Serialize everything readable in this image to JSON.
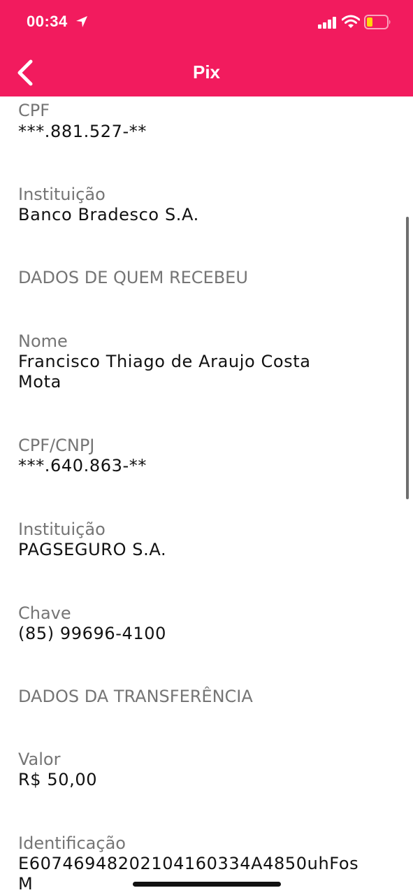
{
  "status_bar": {
    "time": "00:34",
    "icons": [
      "location-arrow-icon",
      "signal-bars-icon",
      "wifi-icon",
      "battery-low-icon"
    ],
    "battery_color": "#ffd60a"
  },
  "header": {
    "title": "Pix",
    "back_icon": "chevron-left-icon",
    "background": "#f21b5e"
  },
  "payer": {
    "cpf_label": "CPF",
    "cpf_value": "***.881.527-**",
    "institution_label": "Instituição",
    "institution_value": "Banco Bradesco S.A."
  },
  "receiver": {
    "section_title": "DADOS DE QUEM RECEBEU",
    "name_label": "Nome",
    "name_line1": "Francisco Thiago de Araujo Costa",
    "name_line2": "Mota",
    "doc_label": "CPF/CNPJ",
    "doc_value": "***.640.863-**",
    "institution_label": "Instituição",
    "institution_value": "PAGSEGURO S.A.",
    "key_label": "Chave",
    "key_value": "(85) 99696-4100"
  },
  "transfer": {
    "section_title": "DADOS DA TRANSFERÊNCIA",
    "amount_label": "Valor",
    "amount_value": "R$ 50,00",
    "id_label": "Identificação",
    "id_line1": "E60746948202104160334A4850uhFos",
    "id_line2": "M"
  }
}
